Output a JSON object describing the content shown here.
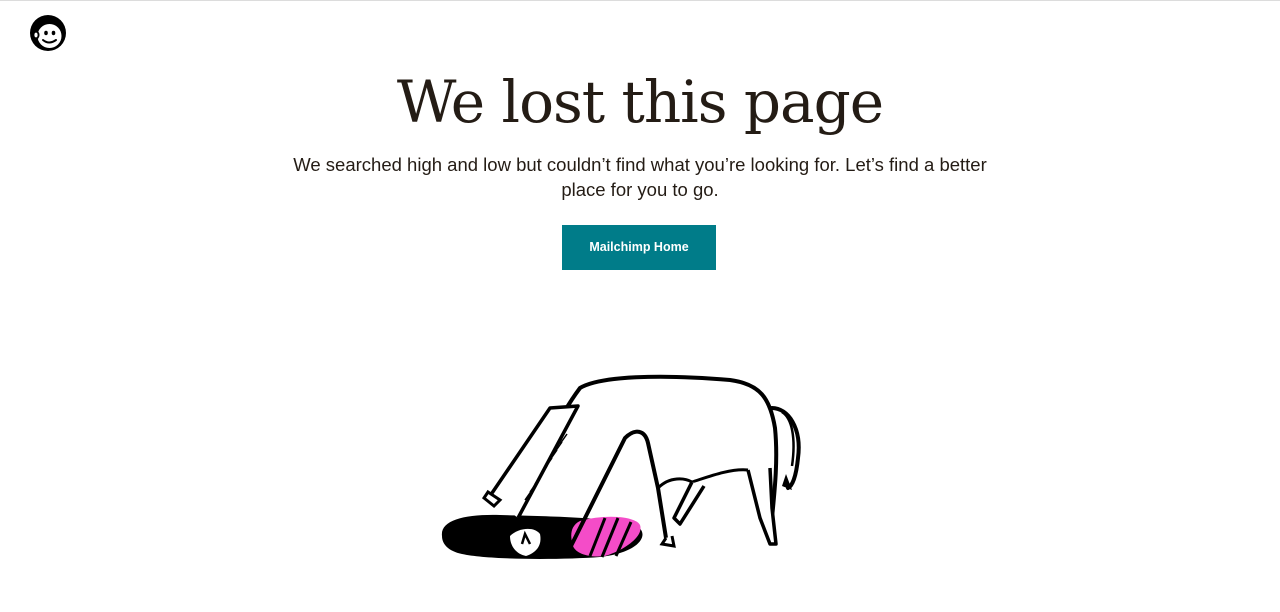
{
  "header": {
    "logo_icon": "mailchimp-freddie-icon"
  },
  "main": {
    "headline": "We lost this page",
    "subtext": "We searched high and low but couldn’t find what you’re looking for. Let’s find a better place for you to go.",
    "home_button_label": "Mailchimp Home"
  },
  "illustration": {
    "subject": "horse-looking-into-hole-icon"
  },
  "colors": {
    "button_bg": "#007c89",
    "button_text": "#ffffff",
    "text": "#241c15",
    "accent_pink": "#f44cc8",
    "ink": "#000000"
  }
}
